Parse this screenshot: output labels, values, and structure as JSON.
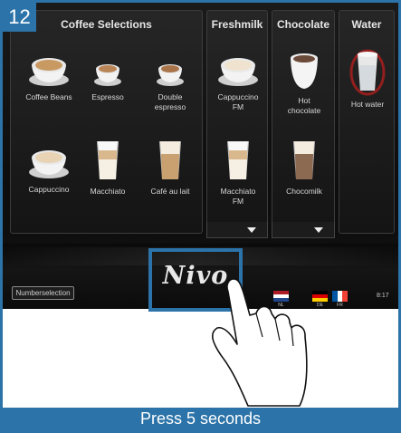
{
  "step": "12",
  "panels": {
    "coffee": {
      "title": "Coffee Selections",
      "items": [
        "Coffee Beans",
        "Espresso",
        "Double espresso",
        "Cappuccino",
        "Macchiato",
        "Café au lait"
      ]
    },
    "freshmilk": {
      "title": "Freshmilk",
      "items": [
        "Cappuccino FM",
        "Macchiato FM"
      ]
    },
    "chocolate": {
      "title": "Chocolate",
      "items": [
        "Hot chocolate",
        "Chocomilk"
      ]
    },
    "water": {
      "title": "Water",
      "items": [
        "Hot water"
      ]
    }
  },
  "bottom": {
    "number_selection": "Numberselection",
    "logo": "Nivo",
    "languages": [
      "NL",
      "DE",
      "FR"
    ],
    "time": "8:17"
  },
  "caption": "Press 5 seconds",
  "colors": {
    "accent": "#2b73a8",
    "screen_bg": "#111111",
    "panel_text": "#e6e6e6"
  }
}
